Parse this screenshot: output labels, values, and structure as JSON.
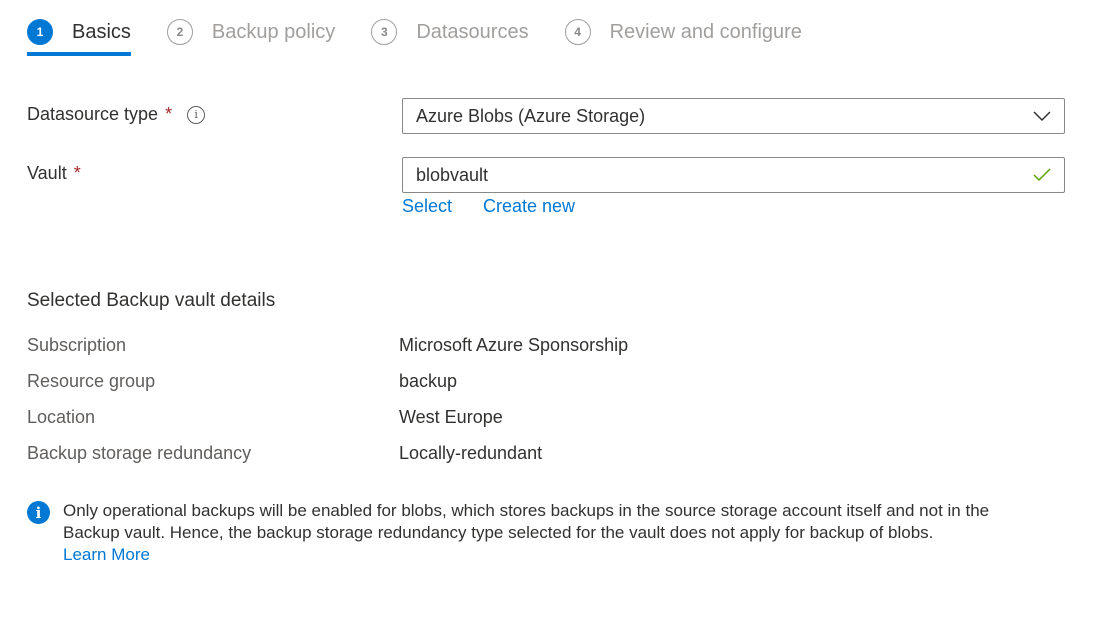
{
  "wizard": {
    "steps": [
      {
        "number": "1",
        "label": "Basics",
        "active": true
      },
      {
        "number": "2",
        "label": "Backup policy",
        "active": false
      },
      {
        "number": "3",
        "label": "Datasources",
        "active": false
      },
      {
        "number": "4",
        "label": "Review and configure",
        "active": false
      }
    ]
  },
  "form": {
    "datasource_type": {
      "label": "Datasource type",
      "required_marker": "*",
      "info_glyph": "i",
      "value": "Azure Blobs (Azure Storage)",
      "icon": "chevron-down-icon"
    },
    "vault": {
      "label": "Vault",
      "required_marker": "*",
      "value": "blobvault",
      "icon": "checkmark-icon",
      "valid_color": "#57a300",
      "links": {
        "select": "Select",
        "create_new": "Create new"
      }
    }
  },
  "details": {
    "title": "Selected Backup vault details",
    "rows": [
      {
        "key": "Subscription",
        "value": "Microsoft Azure Sponsorship"
      },
      {
        "key": "Resource group",
        "value": "backup"
      },
      {
        "key": "Location",
        "value": "West Europe"
      },
      {
        "key": "Backup storage redundancy",
        "value": "Locally-redundant"
      }
    ]
  },
  "info_banner": {
    "icon_glyph": "i",
    "text": "Only operational backups will be enabled for blobs, which stores backups in the source storage account itself and not in the Backup vault. Hence, the backup storage redundancy type selected for the vault does not apply for backup of blobs.",
    "link": "Learn More"
  },
  "colors": {
    "accent": "#0078d4",
    "required": "#a4262c",
    "success": "#57a300"
  }
}
